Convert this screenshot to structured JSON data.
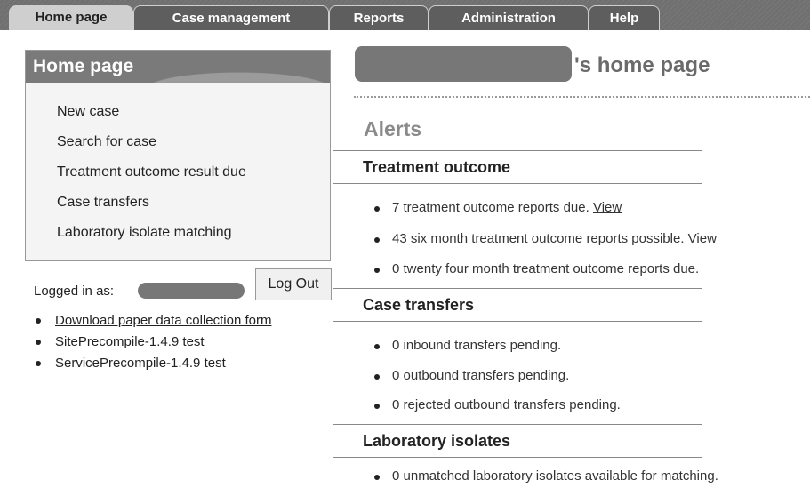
{
  "nav": {
    "tabs": [
      {
        "label": "Home page"
      },
      {
        "label": "Case management"
      },
      {
        "label": "Reports"
      },
      {
        "label": "Administration"
      },
      {
        "label": "Help"
      }
    ]
  },
  "sidebar": {
    "title": "Home page",
    "items": [
      {
        "label": "New case"
      },
      {
        "label": "Search for case"
      },
      {
        "label": "Treatment outcome result due"
      },
      {
        "label": "Case transfers"
      },
      {
        "label": "Laboratory isolate matching"
      }
    ],
    "logged_in_label": "Logged in as:",
    "logout_label": "Log Out",
    "links": [
      {
        "label": "Download paper data collection form"
      },
      {
        "label": "SitePrecompile-1.4.9 test"
      },
      {
        "label": "ServicePrecompile-1.4.9 test"
      }
    ]
  },
  "main": {
    "title_suffix": "'s home page",
    "alerts_heading": "Alerts",
    "sections": [
      {
        "title": "Treatment outcome",
        "items": [
          {
            "text": "7 treatment outcome reports due.",
            "link": "View"
          },
          {
            "text": "43 six month treatment outcome reports possible.",
            "link": "View"
          },
          {
            "text": "0 twenty four month treatment outcome reports due."
          }
        ]
      },
      {
        "title": "Case transfers",
        "items": [
          {
            "text": "0 inbound transfers pending."
          },
          {
            "text": "0 outbound transfers pending."
          },
          {
            "text": "0 rejected outbound transfers pending."
          }
        ]
      },
      {
        "title": "Laboratory isolates",
        "items": [
          {
            "text": "0 unmatched laboratory isolates available for matching."
          }
        ]
      }
    ]
  }
}
